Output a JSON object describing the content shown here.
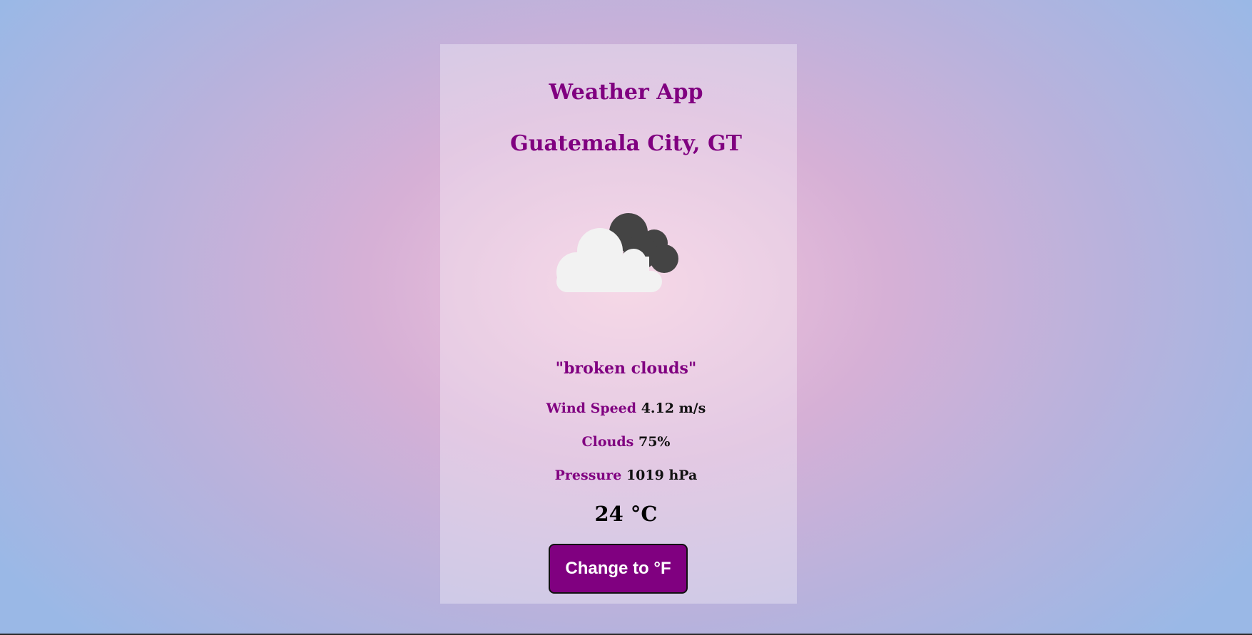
{
  "app": {
    "title": "Weather App",
    "location": "Guatemala City, GT"
  },
  "weather": {
    "icon": "broken-clouds-icon",
    "description": "\"broken clouds\"",
    "wind_speed": {
      "label": "Wind Speed",
      "value": "4.12 m/s"
    },
    "clouds": {
      "label": "Clouds",
      "value": "75%"
    },
    "pressure": {
      "label": "Pressure",
      "value": "1019 hPa"
    },
    "temperature": "24 °C"
  },
  "controls": {
    "change_unit_label": "Change to °F"
  },
  "colors": {
    "accent": "#800080",
    "text": "#111111",
    "button_text": "#ffffff"
  }
}
